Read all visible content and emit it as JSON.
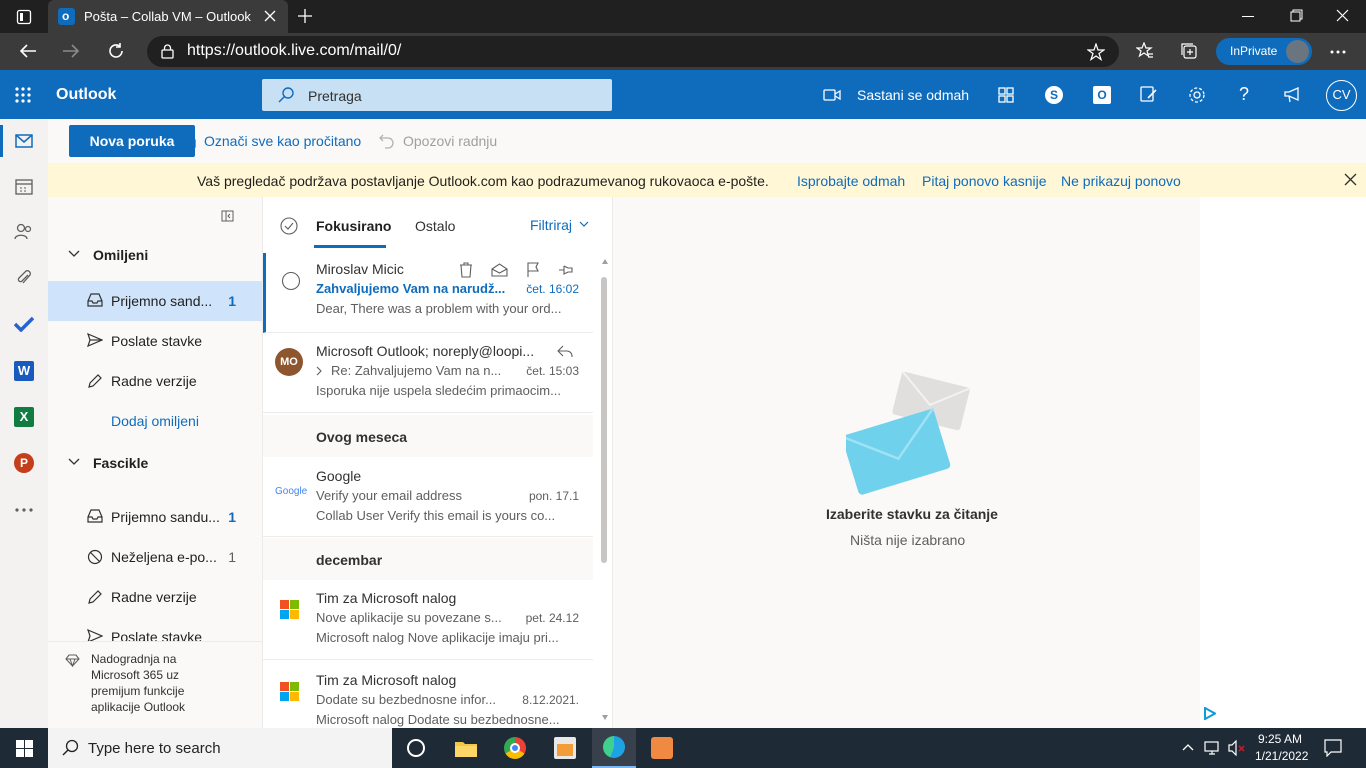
{
  "browser": {
    "tab_title": "Pošta – Collab VM – Outlook",
    "url": "https://outlook.live.com/mail/0/",
    "inprivate_label": "InPrivate"
  },
  "header": {
    "app_name": "Outlook",
    "search_placeholder": "Pretraga",
    "meet_now": "Sastani se odmah",
    "avatar_initials": "CV"
  },
  "commands": {
    "new_message": "Nova poruka",
    "mark_all_read": "Označi sve kao pročitano",
    "undo": "Opozovi radnju"
  },
  "banner": {
    "text": "Vaš pregledač podržava postavljanje Outlook.com kao podrazumevanog rukovaoca e-pošte.",
    "try_now": "Isprobajte odmah",
    "ask_later": "Pitaj ponovo kasnije",
    "dont_show": "Ne prikazuj ponovo"
  },
  "folders": {
    "favorites_title": "Omiljeni",
    "favorites": [
      {
        "label": "Prijemno sand...",
        "count": "1"
      },
      {
        "label": "Poslate stavke",
        "count": ""
      },
      {
        "label": "Radne verzije",
        "count": ""
      }
    ],
    "add_favorite": "Dodaj omiljeni",
    "folders_title": "Fascikle",
    "items": [
      {
        "label": "Prijemno sandu...",
        "count": "1"
      },
      {
        "label": "Neželjena e-po...",
        "count": "1"
      },
      {
        "label": "Radne verzije",
        "count": ""
      },
      {
        "label": "Poslate stavke",
        "count": ""
      }
    ],
    "upgrade_text": "Nadogradnja na Microsoft 365 uz premijum funkcije aplikacije Outlook"
  },
  "list": {
    "tab_focused": "Fokusirano",
    "tab_other": "Ostalo",
    "filter": "Filtriraj",
    "messages": [
      {
        "sender": "Miroslav Micic",
        "subject": "Zahvaljujemo Vam na narudž...",
        "date": "čet. 16:02",
        "preview": "Dear, There was a problem with your ord..."
      },
      {
        "sender": "Microsoft Outlook; noreply@loopi...",
        "subject": "Re: Zahvaljujemo Vam na n...",
        "date": "čet. 15:03",
        "preview": "Isporuka nije uspela sledećim primaocim...",
        "avatar": "MO"
      },
      {
        "section": "Ovog meseca"
      },
      {
        "sender": "Google",
        "subject": "Verify your email address",
        "date": "pon. 17.1",
        "preview": "Collab User Verify this email is yours co...",
        "logo": "Google"
      },
      {
        "section": "decembar"
      },
      {
        "sender": "Tim za Microsoft nalog",
        "subject": "Nove aplikacije su povezane s...",
        "date": "pet. 24.12",
        "preview": "Microsoft nalog Nove aplikacije imaju pri..."
      },
      {
        "sender": "Tim za Microsoft nalog",
        "subject": "Dodate su bezbednosne infor...",
        "date": "8.12.2021.",
        "preview": "Microsoft nalog Dodate su bezbednosne..."
      }
    ]
  },
  "reading": {
    "title": "Izaberite stavku za čitanje",
    "subtitle": "Ništa nije izabrano"
  },
  "taskbar": {
    "search_placeholder": "Type here to search",
    "time": "9:25 AM",
    "date": "1/21/2022"
  },
  "colors": {
    "brand": "#0f6cbd",
    "banner_bg": "#fff7d6",
    "selected": "#cfe4fa"
  }
}
